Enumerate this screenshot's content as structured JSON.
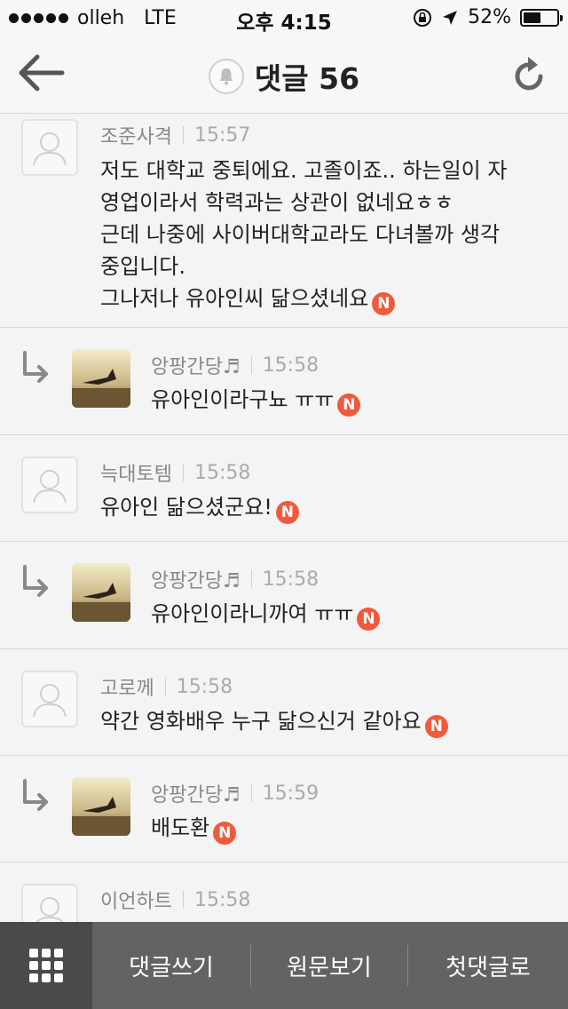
{
  "status_bar": {
    "carrier": "olleh",
    "network": "LTE",
    "time": "오후 4:15",
    "battery": "52%",
    "battery_level": 0.52
  },
  "header": {
    "title": "댓글 56",
    "icons": [
      "back-arrow-icon",
      "bell-icon",
      "refresh-icon"
    ]
  },
  "comments": [
    {
      "author": "조준사격",
      "time": "15:57",
      "reply": false,
      "lines": [
        "저도 대학교 중퇴에요. 고졸이죠.. 하는일이 자",
        "영업이라서 학력과는 상관이 없네요ㅎㅎ",
        "근데 나중에 사이버대학교라도 다녀볼까 생각",
        "중입니다.",
        "그나저나 유아인씨 닮으셨네요"
      ],
      "new": true
    },
    {
      "author": "앙팡간당♬",
      "time": "15:58",
      "reply": true,
      "lines": [
        "유아인이라구뇨 ㅠㅠ"
      ],
      "new": true
    },
    {
      "author": "늑대토템",
      "time": "15:58",
      "reply": false,
      "lines": [
        "유아인 닮으셨군요!"
      ],
      "new": true
    },
    {
      "author": "앙팡간당♬",
      "time": "15:58",
      "reply": true,
      "lines": [
        "유아인이라니까여 ㅠㅠ"
      ],
      "new": true
    },
    {
      "author": "고로께",
      "time": "15:58",
      "reply": false,
      "lines": [
        "약간 영화배우 누구 닮으신거 같아요"
      ],
      "new": true
    },
    {
      "author": "앙팡간당♬",
      "time": "15:59",
      "reply": true,
      "lines": [
        "배도환"
      ],
      "new": true
    },
    {
      "author": "이언하트",
      "time": "15:58",
      "reply": false,
      "lines": [],
      "new": false
    }
  ],
  "new_badge": "N",
  "toolbar": {
    "write": "댓글쓰기",
    "original": "원문보기",
    "first": "첫댓글로"
  }
}
